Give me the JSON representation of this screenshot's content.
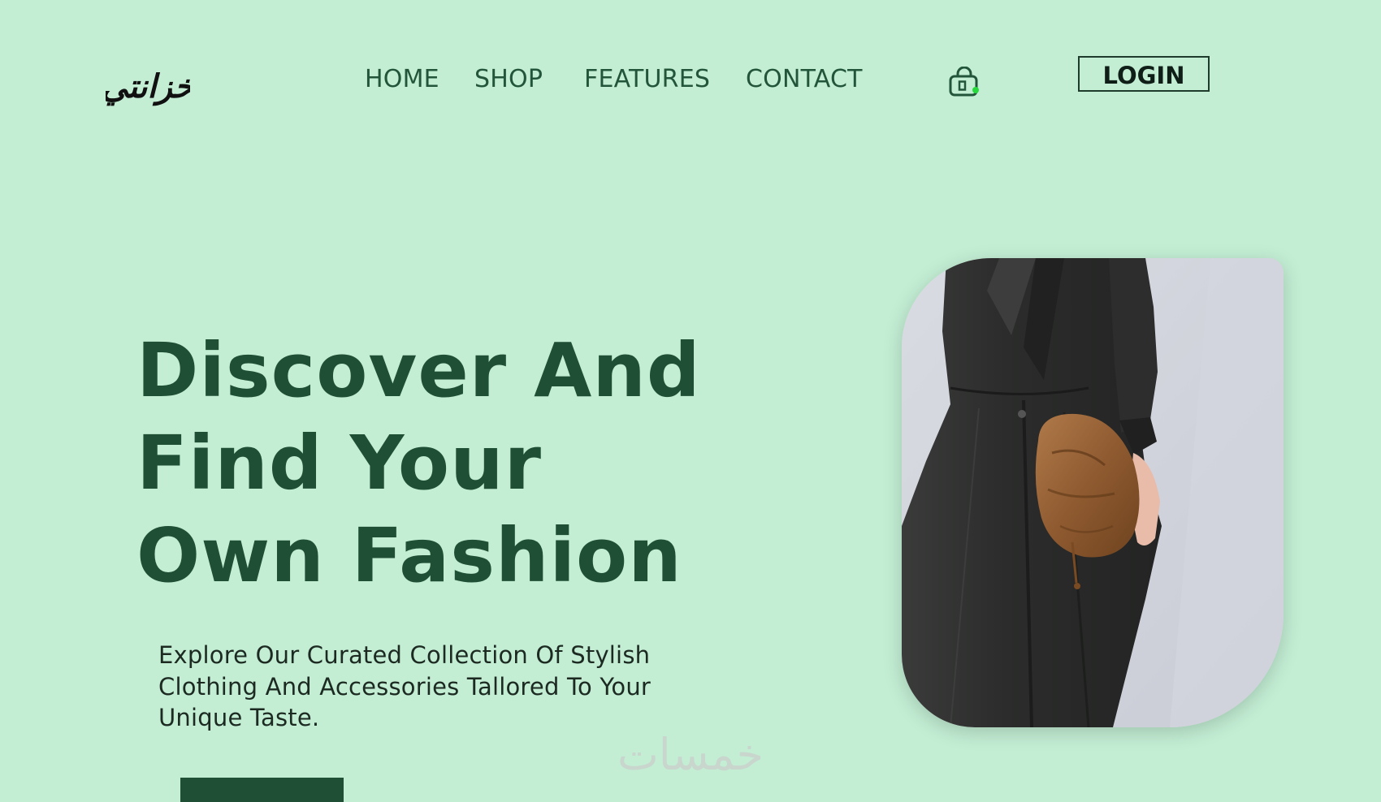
{
  "brand": {
    "logo_text": "خزانتي"
  },
  "nav": {
    "items": [
      {
        "label": "HOME"
      },
      {
        "label": "SHOP"
      },
      {
        "label": "FEATURES"
      },
      {
        "label": "CONTACT"
      }
    ]
  },
  "header": {
    "cart_icon": "shopping-bag-icon",
    "login_label": "LOGIN"
  },
  "hero": {
    "title_lines": [
      "Discover And",
      "Find Your",
      "Own Fashion"
    ],
    "description": "Explore Our Curated Collection Of Stylish Clothing And Accessories Tallored To Your Unique Taste.",
    "image": "woman in black wrap dress holding brown leather pouch bag"
  },
  "watermark": {
    "text": "خمسات"
  },
  "colors": {
    "background": "#c3eed4",
    "primary_dark_green": "#1f4f35",
    "nav_text": "#22553a",
    "cart_badge": "#27d93c"
  }
}
